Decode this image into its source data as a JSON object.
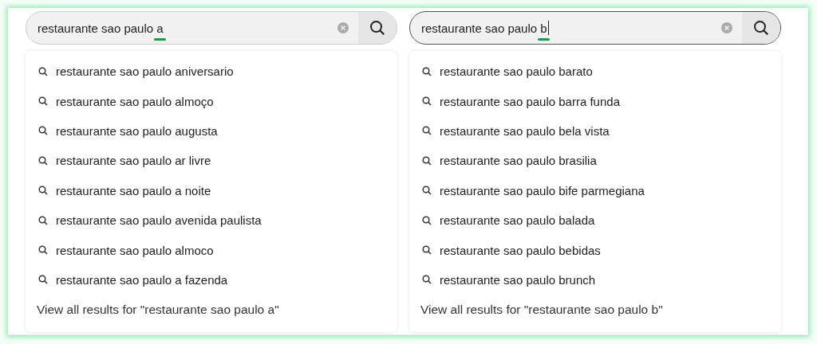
{
  "panels": [
    {
      "query": "restaurante sao paulo a",
      "focused": false,
      "underline_last_letter": true,
      "suggestions": [
        "restaurante sao paulo aniversario",
        "restaurante sao paulo almoço",
        "restaurante sao paulo augusta",
        "restaurante sao paulo ar livre",
        "restaurante sao paulo a noite",
        "restaurante sao paulo avenida paulista",
        "restaurante sao paulo almoco",
        "restaurante sao paulo a fazenda"
      ],
      "view_all": "View all results for \"restaurante sao paulo a\""
    },
    {
      "query": "restaurante sao paulo b",
      "focused": true,
      "underline_last_letter": true,
      "suggestions": [
        "restaurante sao paulo barato",
        "restaurante sao paulo barra funda",
        "restaurante sao paulo bela vista",
        "restaurante sao paulo brasilia",
        "restaurante sao paulo bife parmegiana",
        "restaurante sao paulo balada",
        "restaurante sao paulo bebidas",
        "restaurante sao paulo brunch"
      ],
      "view_all": "View all results for \"restaurante sao paulo b\""
    }
  ]
}
